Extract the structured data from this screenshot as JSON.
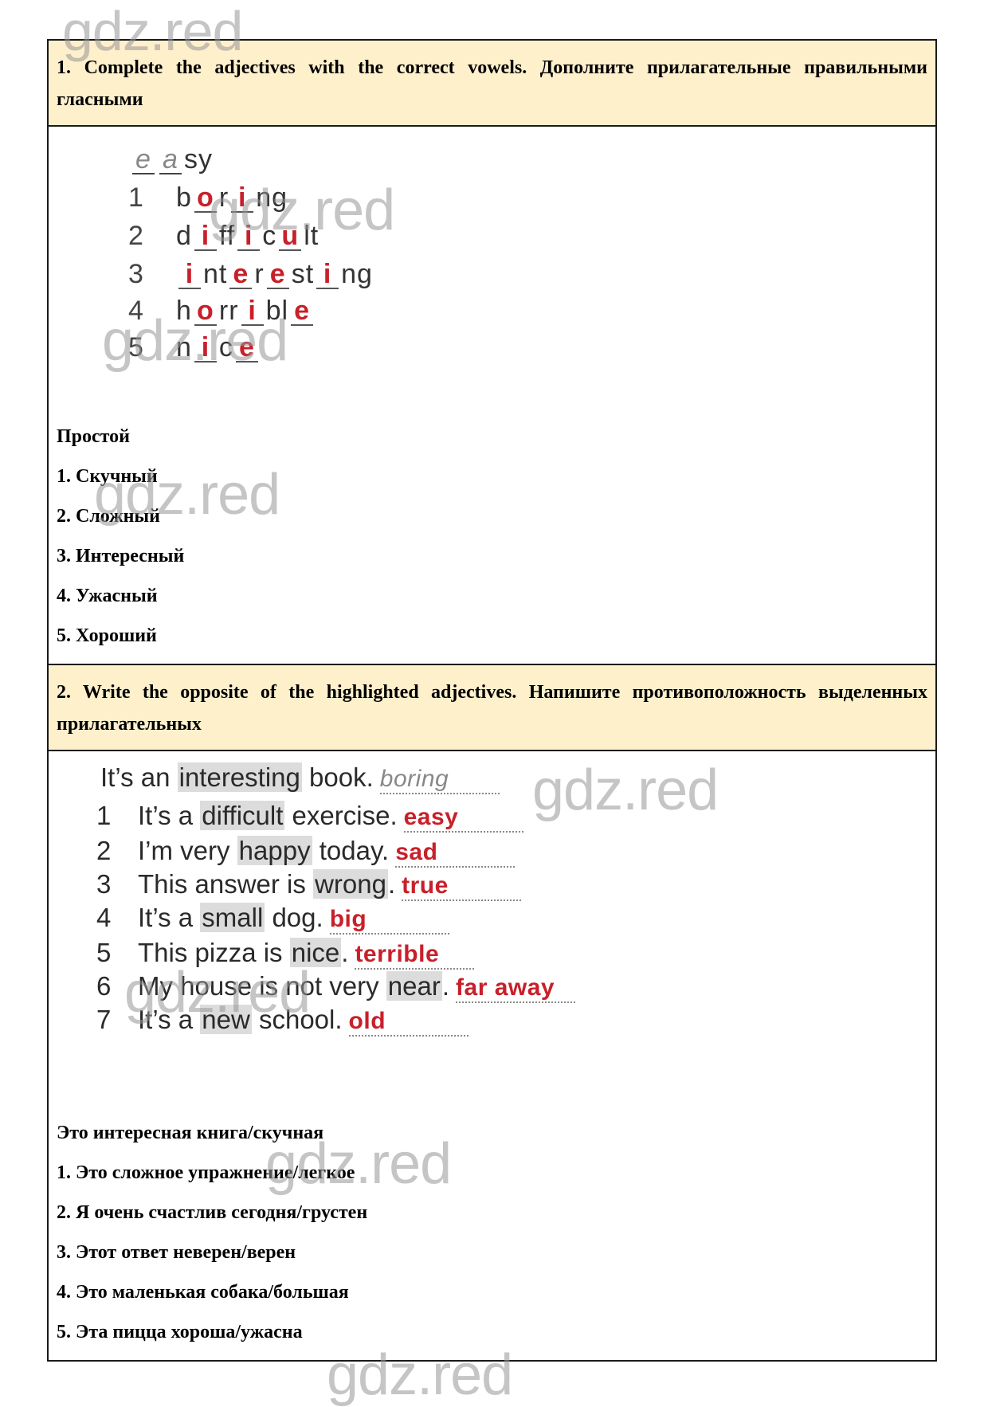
{
  "watermark_text": "gdz.red",
  "colors": {
    "header_bg": "#fff0cc",
    "answer": "#c8202a",
    "border": "#1a1a1a"
  },
  "task1": {
    "header": "1. Complete the adjectives with the correct vowels. Дополните прилагательные правильными гласными",
    "exercise": {
      "example": {
        "gaps": [
          "e",
          "a"
        ],
        "tail": "sy"
      },
      "rows": [
        {
          "num": "1",
          "parts": [
            "b",
            "{o}",
            "r",
            "{i}",
            "ng"
          ]
        },
        {
          "num": "2",
          "parts": [
            "d",
            "{i}",
            "ff",
            "{i}",
            "c",
            "{u}",
            "lt"
          ]
        },
        {
          "num": "3",
          "parts": [
            "{i}",
            "nt",
            "{e}",
            "r",
            "{e}",
            "st",
            "{i}",
            "ng"
          ]
        },
        {
          "num": "4",
          "parts": [
            "h",
            "{o}",
            "rr",
            "{i}",
            "bl",
            "{e}"
          ]
        },
        {
          "num": "5",
          "parts": [
            "n",
            "{i}",
            "c",
            "{e}"
          ]
        }
      ]
    },
    "translations": [
      "Простой",
      "1. Скучный",
      "2. Сложный",
      "3. Интересный",
      "4. Ужасный",
      "5. Хороший"
    ]
  },
  "task2": {
    "header": "2. Write the opposite of the highlighted adjectives. Напишите противоположность выделенных прилагательных",
    "exercise": {
      "example": {
        "before": "It’s an ",
        "highlight": "interesting",
        "after": " book.",
        "answer": "boring"
      },
      "rows": [
        {
          "num": "1",
          "before": "It’s a ",
          "highlight": "difficult",
          "after": " exercise.",
          "answer": "easy"
        },
        {
          "num": "2",
          "before": "I’m very ",
          "highlight": "happy",
          "after": " today.",
          "answer": "sad"
        },
        {
          "num": "3",
          "before": "This answer is ",
          "highlight": "wrong",
          "after": ".",
          "answer": "true"
        },
        {
          "num": "4",
          "before": "It’s a ",
          "highlight": "small",
          "after": " dog.",
          "answer": "big"
        },
        {
          "num": "5",
          "before": "This pizza is ",
          "highlight": "nice",
          "after": ".",
          "answer": "terrible"
        },
        {
          "num": "6",
          "before": "My house is not very ",
          "highlight": "near",
          "after": ".",
          "answer": "far away"
        },
        {
          "num": "7",
          "before": "It’s a ",
          "highlight": "new",
          "after": " school.",
          "answer": "old"
        }
      ]
    },
    "translations": [
      "Это интересная книга/скучная",
      "1. Это сложное упражнение/легкое",
      "2. Я очень счастлив сегодня/грустен",
      "3. Этот ответ неверен/верен",
      "4. Это маленькая собака/большая",
      "5. Эта пицца хороша/ужасна"
    ]
  }
}
